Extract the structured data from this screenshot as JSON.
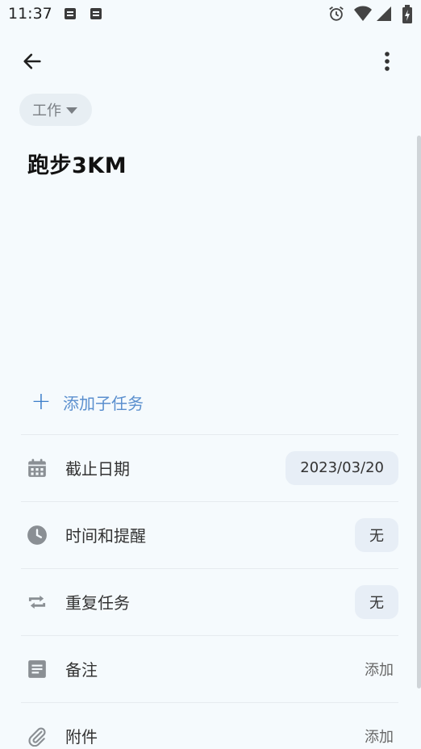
{
  "status_bar": {
    "time": "11:37"
  },
  "toolbar": {
    "back_icon": "arrow-left-icon",
    "more_icon": "more-vert-icon"
  },
  "category": {
    "label": "工作"
  },
  "task": {
    "title": "跑步3KM"
  },
  "subtask": {
    "label": "添加子任务"
  },
  "rows": [
    {
      "label": "截止日期",
      "value": "2023/03/20",
      "icon": "calendar-icon"
    },
    {
      "label": "时间和提醒",
      "value": "无",
      "icon": "clock-icon"
    },
    {
      "label": "重复任务",
      "value": "无",
      "icon": "repeat-icon"
    },
    {
      "label": "备注",
      "value": "添加",
      "icon": "note-icon"
    },
    {
      "label": "附件",
      "value": "添加",
      "icon": "paperclip-icon"
    }
  ],
  "colors": {
    "accent": "#3c7ec9",
    "background": "#f5fafd",
    "chip": "#e7eef6"
  }
}
